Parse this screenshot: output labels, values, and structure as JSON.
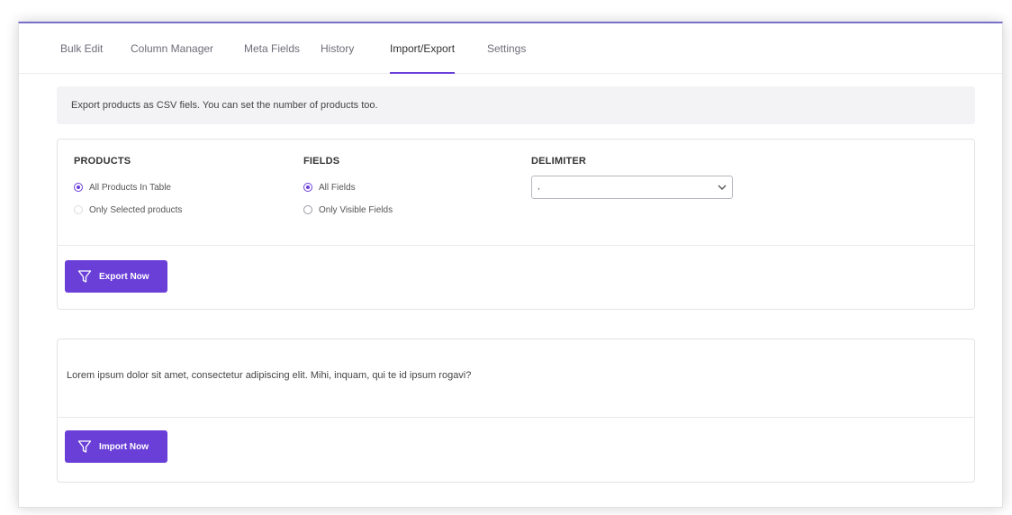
{
  "tabs": [
    {
      "label": "Bulk Edit",
      "active": false
    },
    {
      "label": "Column Manager",
      "active": false
    },
    {
      "label": "Meta Fields",
      "active": false
    },
    {
      "label": "History",
      "active": false
    },
    {
      "label": "Import/Export",
      "active": true
    },
    {
      "label": "Settings",
      "active": false
    }
  ],
  "notice": {
    "text": "Export products as CSV fiels. You can set the number of products too."
  },
  "export": {
    "products": {
      "title": "PRODUCTS",
      "options": [
        "All Products In Table",
        "Only Selected products"
      ],
      "selected": "All Products In Table"
    },
    "fields": {
      "title": "FIELDS",
      "options": [
        "All Fields",
        "Only Visible Fields"
      ],
      "selected": "All Fields"
    },
    "delimiter": {
      "title": "DELIMITER",
      "value": ","
    },
    "button_label": "Export Now"
  },
  "import": {
    "description": "Lorem ipsum dolor sit amet, consectetur adipiscing elit. Mihi, inquam, qui te id ipsum rogavi?",
    "button_label": "Import Now"
  },
  "colors": {
    "accent": "#6a3fd8"
  },
  "icons": {
    "button_icon": "filter-icon",
    "select_icon": "chevron-down-icon"
  }
}
